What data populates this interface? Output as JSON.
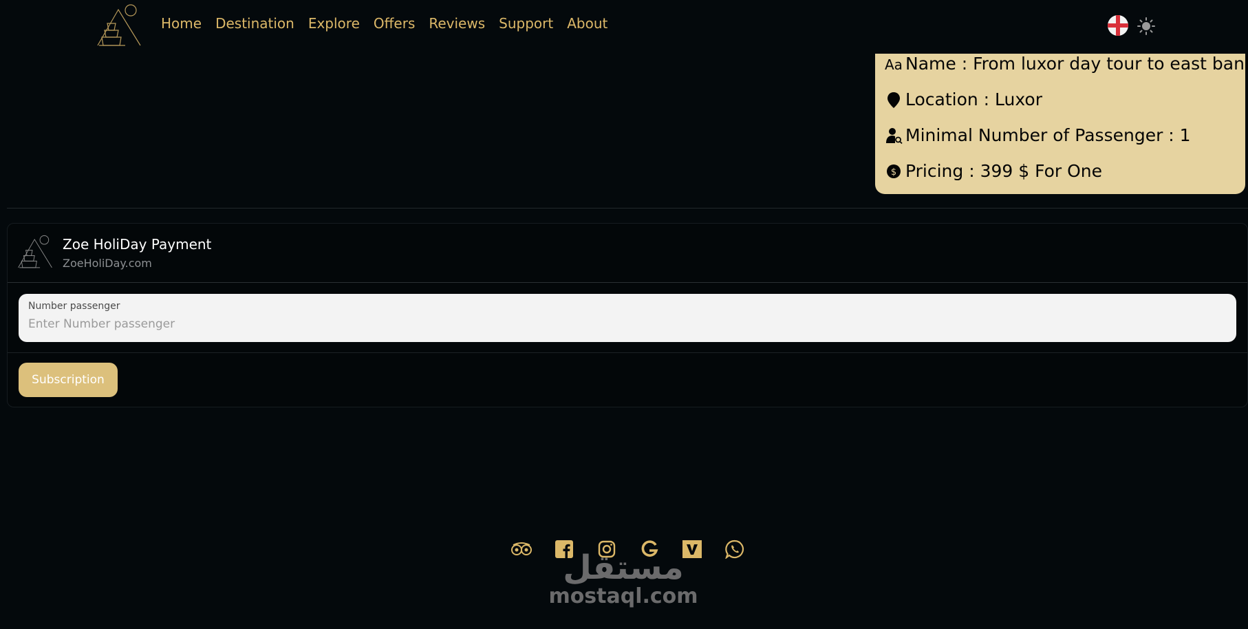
{
  "nav": {
    "links": [
      "Home",
      "Destination",
      "Explore",
      "Offers",
      "Reviews",
      "Support",
      "About"
    ]
  },
  "colors": {
    "accent": "#dcb868",
    "card": "#e6d3a0",
    "background": "#04090c",
    "button": "#dcc07c"
  },
  "tour_card": {
    "name_label": "Name : From luxor day tour to east bank",
    "location_label": "Location : Luxor",
    "min_passengers_label": "Minimal Number of Passenger : 1",
    "pricing_label": "Pricing :  399 $ For One"
  },
  "payment": {
    "title": "Zoe HoliDay Payment",
    "domain": "ZoeHoliDay.com",
    "passenger_label": "Number passenger",
    "passenger_placeholder": "Enter Number passenger",
    "submit_label": "Subscription"
  },
  "footer": {
    "social_icons": [
      "tripadvisor-icon",
      "facebook-icon",
      "instagram-icon",
      "google-icon",
      "viator-icon",
      "whatsapp-icon"
    ]
  },
  "watermark": {
    "arabic": "مستقل",
    "latin": "mostaql.com"
  }
}
